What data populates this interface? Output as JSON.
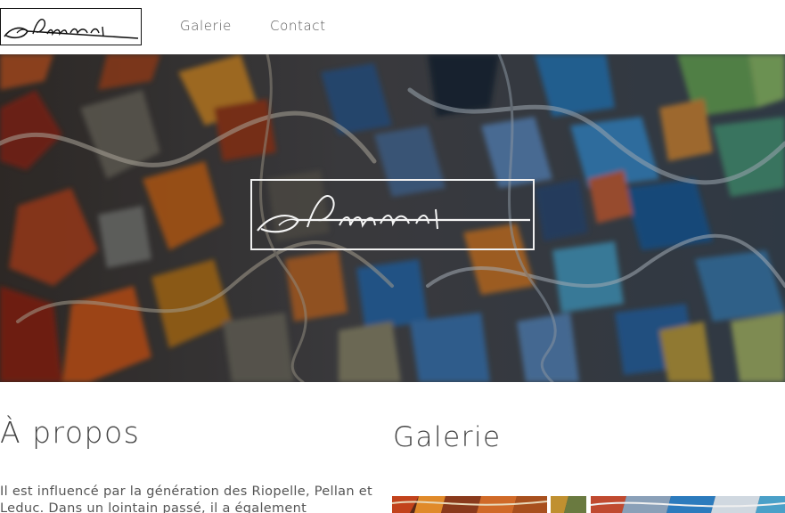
{
  "header": {
    "logo_alt": "Signature logo",
    "nav": [
      {
        "label": "Galerie"
      },
      {
        "label": "Contact"
      }
    ]
  },
  "hero": {
    "logo_alt": "Signature logo"
  },
  "about": {
    "title": "À propos",
    "text": "Il est influencé par la génération des Riopelle, Pellan et Leduc. Dans un lointain passé, il a également"
  },
  "gallery": {
    "title": "Galerie",
    "thumbnails": [
      {
        "icon": "painting-thumbnail-warm"
      },
      {
        "icon": "painting-thumbnail-mixed"
      },
      {
        "icon": "painting-thumbnail-cool"
      }
    ]
  },
  "colors": {
    "text": "#444444",
    "nav_text": "#555555",
    "hero_border": "#f0f0f0"
  }
}
